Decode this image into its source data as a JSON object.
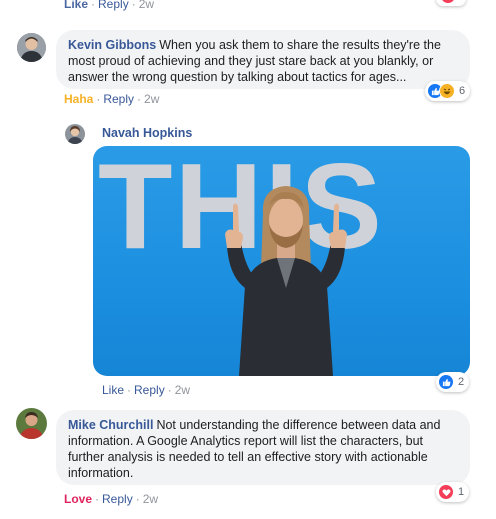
{
  "top_actions": {
    "like": "Like",
    "reply": "Reply",
    "time": "2w"
  },
  "comments": [
    {
      "author": "Kevin Gibbons",
      "text": "When you ask them to share the results they're the most proud of achieving and they just stare back at you blankly, or answer the wrong question by talking about tactics for ages...",
      "reaction_label": "Haha",
      "reply": "Reply",
      "time": "2w",
      "reaction_count": "6"
    },
    {
      "author": "Navah Hopkins",
      "gif_text": "THIS",
      "like": "Like",
      "reply": "Reply",
      "time": "2w",
      "reaction_count": "2"
    },
    {
      "author": "Mike Churchill",
      "text": "Not understanding the difference between data and information. A Google Analytics report will list the characters, but further analysis is needed to tell an effective story with actionable information.",
      "reaction_label": "Love",
      "reply": "Reply",
      "time": "2w",
      "reaction_count": "1"
    }
  ],
  "colors": {
    "link_blue": "#385898",
    "haha_yellow": "#f7b125",
    "love_red": "#e0245e",
    "like_blue": "#1877f2",
    "bubble_gray": "#f2f3f5",
    "gif_blue": "#1c8fe0"
  }
}
